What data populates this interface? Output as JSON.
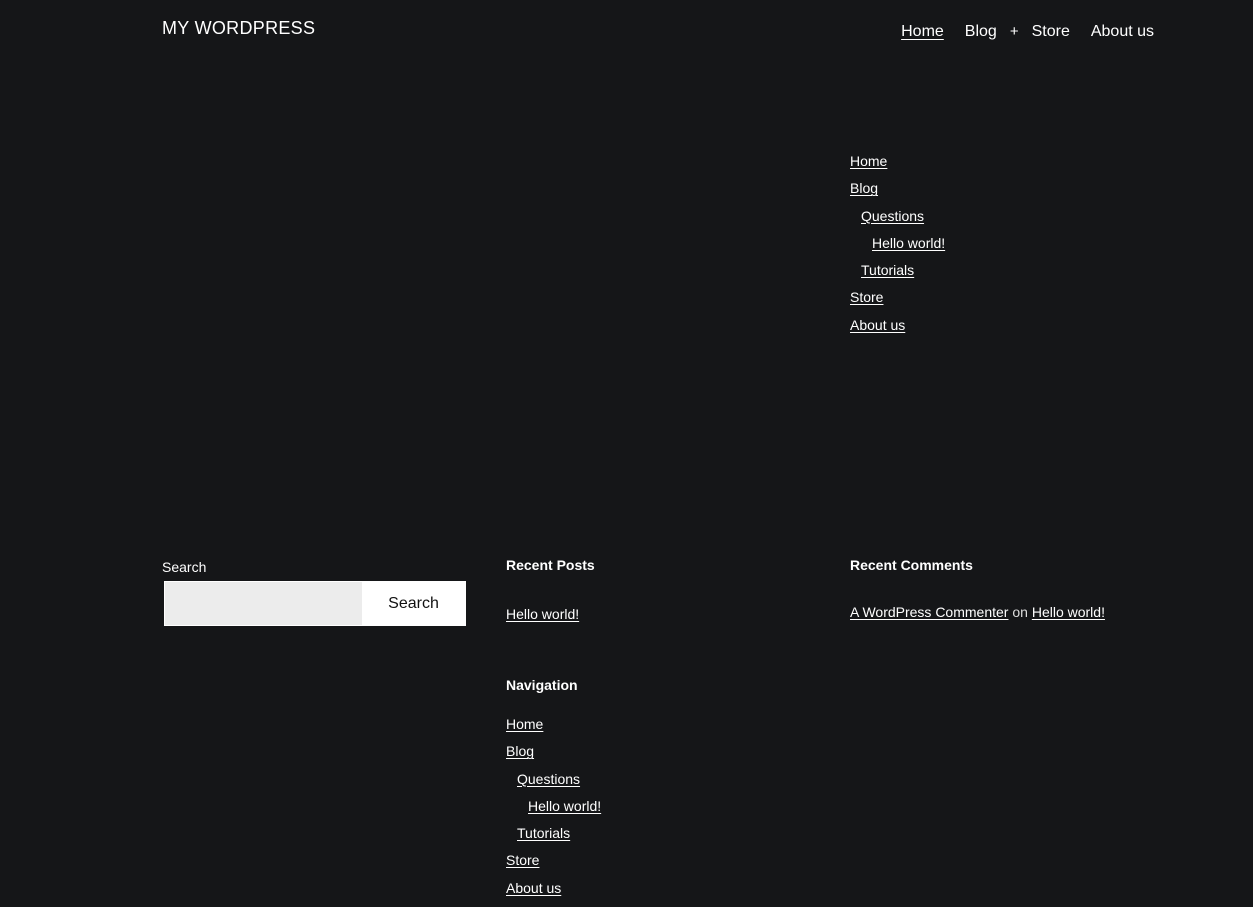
{
  "site": {
    "title": "MY WORDPRESS"
  },
  "header_nav": {
    "items": [
      {
        "label": "Home",
        "current": true
      },
      {
        "label": "Blog"
      },
      {
        "label": "+"
      },
      {
        "label": "Store"
      },
      {
        "label": "About us"
      }
    ]
  },
  "page_list": [
    {
      "label": "Home",
      "level": 0
    },
    {
      "label": "Blog",
      "level": 0
    },
    {
      "label": "Questions",
      "level": 1
    },
    {
      "label": "Hello world!",
      "level": 2
    },
    {
      "label": "Tutorials",
      "level": 1
    },
    {
      "label": "Store",
      "level": 0
    },
    {
      "label": "About us",
      "level": 0
    }
  ],
  "search": {
    "label": "Search",
    "value": "",
    "placeholder": "",
    "button": "Search"
  },
  "recent_posts": {
    "title": "Recent Posts",
    "posts": [
      "Hello world!"
    ]
  },
  "navigation": {
    "title": "Navigation"
  },
  "recent_comments": {
    "title": "Recent Comments",
    "author": "A WordPress Commenter",
    "on": "on",
    "post": "Hello world!"
  },
  "colors": {
    "background": "#151618",
    "text": "#ffffff",
    "input_background": "#ececec"
  }
}
